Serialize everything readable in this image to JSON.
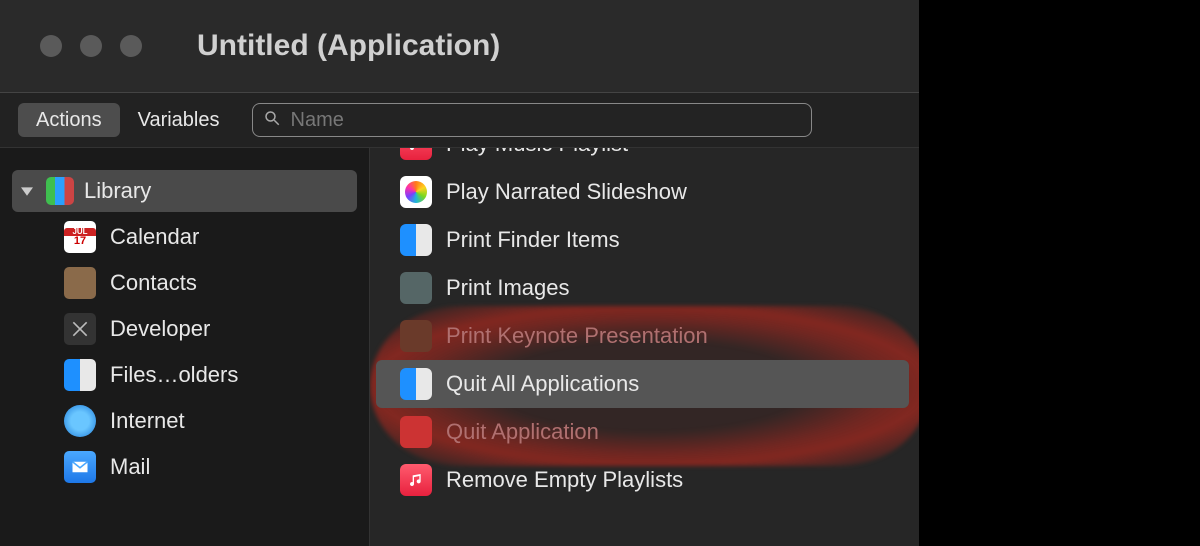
{
  "window": {
    "title": "Untitled (Application)"
  },
  "toolbar": {
    "tabs": {
      "actions": "Actions",
      "variables": "Variables"
    },
    "search_placeholder": "Name"
  },
  "sidebar": {
    "library_label": "Library",
    "items": [
      {
        "label": "Calendar",
        "icon": "calendar-icon"
      },
      {
        "label": "Contacts",
        "icon": "contacts-icon"
      },
      {
        "label": "Developer",
        "icon": "developer-icon"
      },
      {
        "label": "Files…olders",
        "icon": "finder-icon"
      },
      {
        "label": "Internet",
        "icon": "internet-icon"
      },
      {
        "label": "Mail",
        "icon": "mail-icon"
      }
    ]
  },
  "actions": {
    "items": [
      {
        "label": "Play Music Playlist",
        "icon": "music-icon",
        "partial_top": true
      },
      {
        "label": "Play Narrated Slideshow",
        "icon": "photos-icon"
      },
      {
        "label": "Print Finder Items",
        "icon": "finder-icon"
      },
      {
        "label": "Print Images",
        "icon": "preview-icon"
      },
      {
        "label": "Print Keynote Presentation",
        "icon": "keynote-icon",
        "dim": true
      },
      {
        "label": "Quit All Applications",
        "icon": "finder-icon",
        "selected": true
      },
      {
        "label": "Quit Application",
        "icon": "app-icon",
        "dim": true
      },
      {
        "label": "Remove Empty Playlists",
        "icon": "music-icon"
      }
    ]
  },
  "annotation": {
    "highlighted_action": "Quit All Applications"
  }
}
